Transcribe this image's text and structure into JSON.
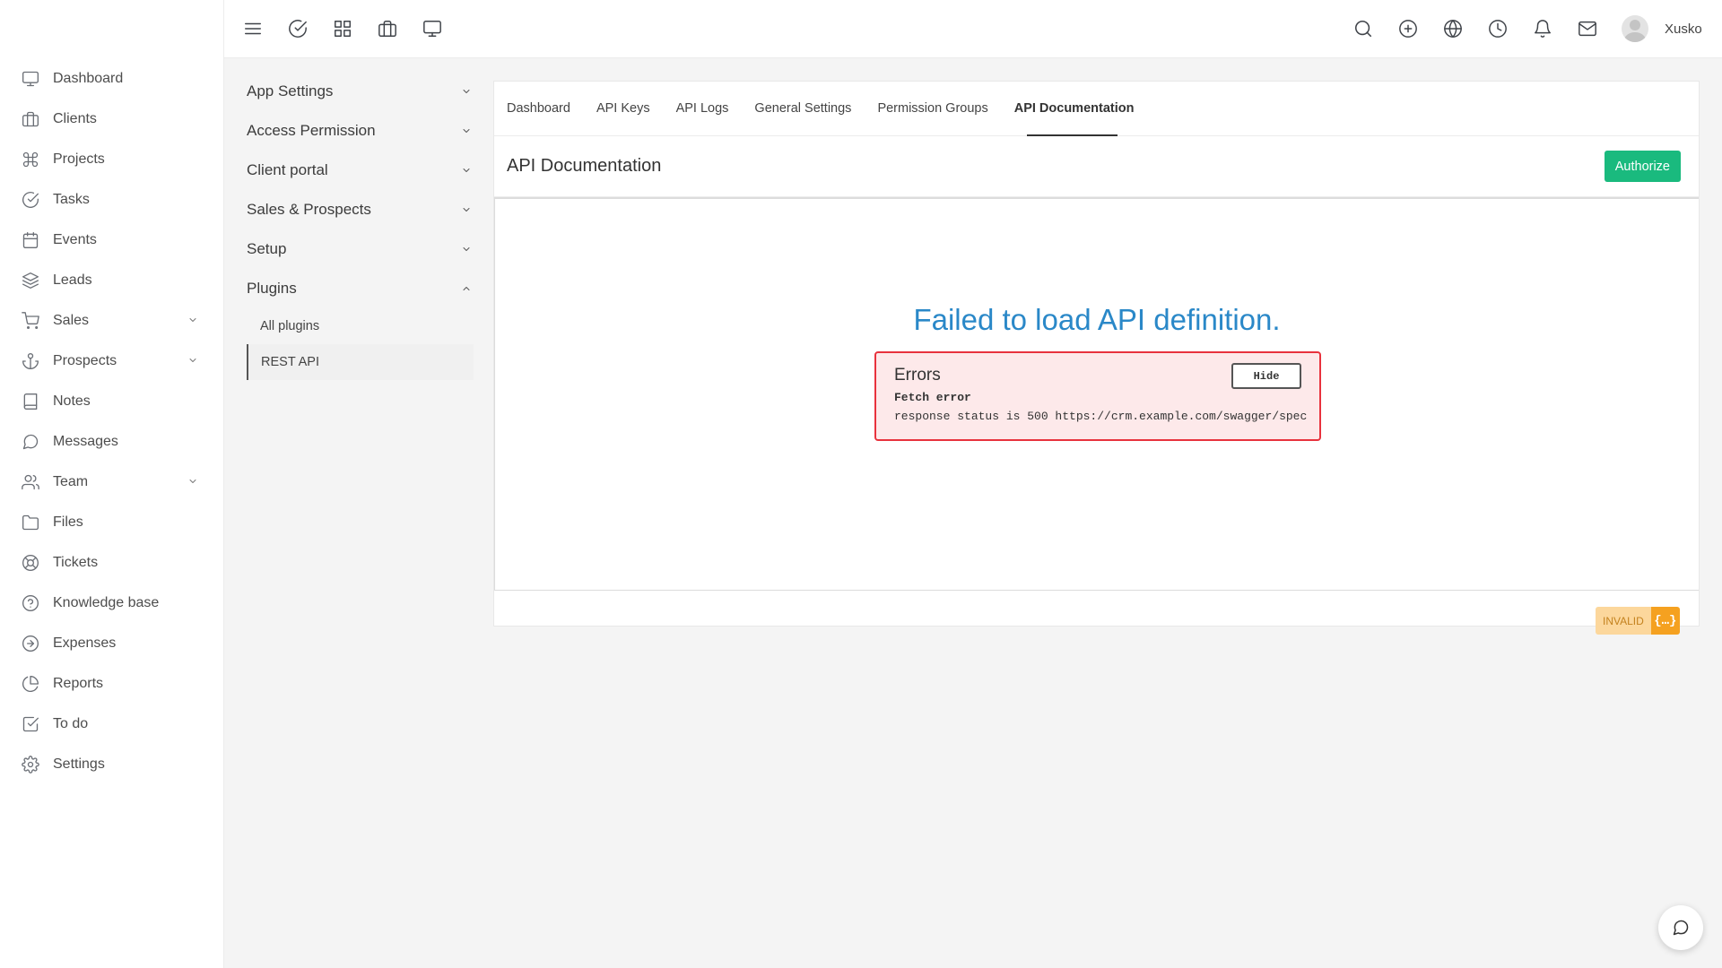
{
  "sidebar": {
    "items": [
      {
        "label": "Dashboard",
        "icon": "monitor-icon"
      },
      {
        "label": "Clients",
        "icon": "briefcase-icon"
      },
      {
        "label": "Projects",
        "icon": "command-icon"
      },
      {
        "label": "Tasks",
        "icon": "check-circle-icon"
      },
      {
        "label": "Events",
        "icon": "calendar-icon"
      },
      {
        "label": "Leads",
        "icon": "layers-icon"
      },
      {
        "label": "Sales",
        "icon": "cart-icon",
        "has_submenu": true
      },
      {
        "label": "Prospects",
        "icon": "anchor-icon",
        "has_submenu": true
      },
      {
        "label": "Notes",
        "icon": "book-icon"
      },
      {
        "label": "Messages",
        "icon": "message-circle-icon"
      },
      {
        "label": "Team",
        "icon": "users-icon",
        "has_submenu": true
      },
      {
        "label": "Files",
        "icon": "folder-icon"
      },
      {
        "label": "Tickets",
        "icon": "life-buoy-icon"
      },
      {
        "label": "Knowledge base",
        "icon": "help-circle-icon"
      },
      {
        "label": "Expenses",
        "icon": "arrow-circle-icon"
      },
      {
        "label": "Reports",
        "icon": "pie-chart-icon"
      },
      {
        "label": "To do",
        "icon": "check-square-icon"
      },
      {
        "label": "Settings",
        "icon": "gear-icon"
      }
    ]
  },
  "topbar": {
    "left_icons": [
      "menu-icon",
      "check-circle-icon",
      "grid-icon",
      "briefcase-icon",
      "monitor-icon"
    ],
    "right_icons": [
      "search-icon",
      "plus-circle-icon",
      "globe-icon",
      "clock-icon",
      "bell-icon",
      "mail-icon"
    ],
    "username": "Xusko"
  },
  "settings_menu": {
    "items": [
      {
        "label": "App Settings",
        "expanded": false
      },
      {
        "label": "Access Permission",
        "expanded": false
      },
      {
        "label": "Client portal",
        "expanded": false
      },
      {
        "label": "Sales & Prospects",
        "expanded": false
      },
      {
        "label": "Setup",
        "expanded": false
      },
      {
        "label": "Plugins",
        "expanded": true
      }
    ],
    "plugins_sub": [
      {
        "label": "All plugins",
        "active": false
      },
      {
        "label": "REST API",
        "active": true
      }
    ]
  },
  "tabs": [
    {
      "label": "Dashboard"
    },
    {
      "label": "API Keys"
    },
    {
      "label": "API Logs"
    },
    {
      "label": "General Settings"
    },
    {
      "label": "Permission Groups"
    },
    {
      "label": "API Documentation",
      "active": true
    }
  ],
  "section": {
    "title": "API Documentation",
    "authorize_label": "Authorize"
  },
  "swagger": {
    "fail_title": "Failed to load API definition.",
    "errors_title": "Errors",
    "hide_label": "Hide",
    "error_name": "Fetch error",
    "error_message": "response status is 500 https://crm.example.com/swagger/spec",
    "validator_label": "INVALID",
    "validator_icon": "{…}"
  },
  "colors": {
    "accent_green": "#1aba7e",
    "error_red": "#e8323d",
    "title_blue": "#2a88c8",
    "invalid_orange": "#f5a120"
  }
}
